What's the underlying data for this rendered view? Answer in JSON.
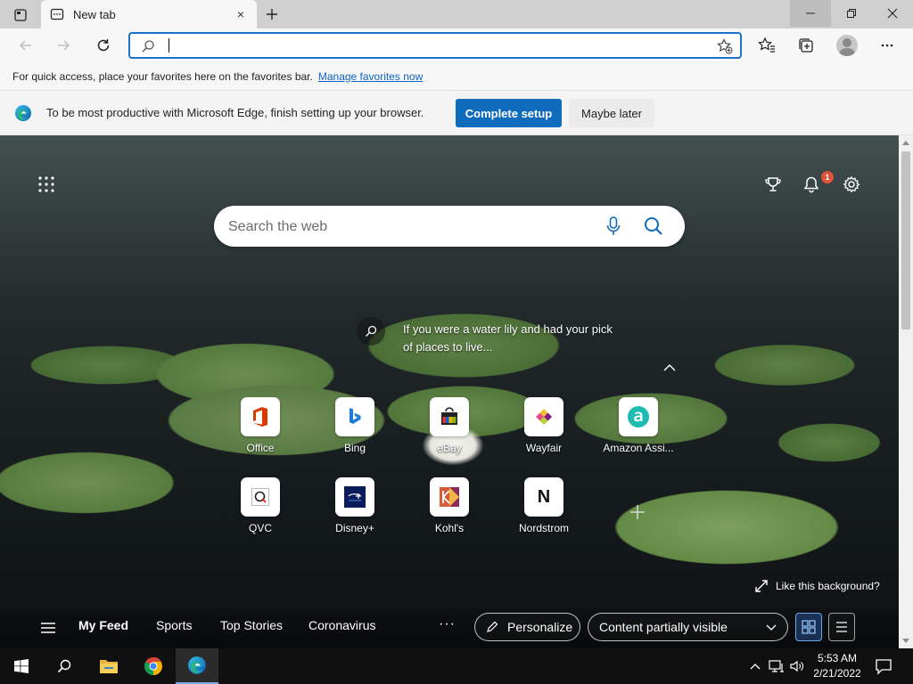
{
  "tab": {
    "title": "New tab",
    "close": "×"
  },
  "address": {
    "value": "",
    "placeholder": ""
  },
  "favorites_bar": {
    "text": "For quick access, place your favorites here on the favorites bar.",
    "link": "Manage favorites now"
  },
  "banner": {
    "text": "To be most productive with Microsoft Edge, finish setting up your browser.",
    "primary": "Complete setup",
    "secondary": "Maybe later"
  },
  "ntp": {
    "search_placeholder": "Search the web",
    "notification_count": "1",
    "story_line1": "If you were a water lily and had your pick",
    "story_line2": "of places to live...",
    "quick_links": [
      {
        "label": "Office",
        "icon": "office-icon"
      },
      {
        "label": "Bing",
        "icon": "bing-icon"
      },
      {
        "label": "eBay",
        "icon": "ebay-icon"
      },
      {
        "label": "Wayfair",
        "icon": "wayfair-icon"
      },
      {
        "label": "Amazon Assi...",
        "icon": "amazon-assistant-icon"
      },
      {
        "label": "QVC",
        "icon": "qvc-icon"
      },
      {
        "label": "Disney+",
        "icon": "disney-plus-icon"
      },
      {
        "label": "Kohl's",
        "icon": "kohls-icon"
      },
      {
        "label": "Nordstrom",
        "icon": "nordstrom-icon"
      }
    ],
    "nordstrom_letter": "N",
    "like_background": "Like this background?",
    "feed": {
      "tabs": [
        "My Feed",
        "Sports",
        "Top Stories",
        "Coronavirus"
      ],
      "more": "···",
      "personalize": "Personalize",
      "content_visibility": "Content partially visible"
    }
  },
  "taskbar": {
    "time": "5:53 AM",
    "date": "2/21/2022"
  },
  "colors": {
    "accent": "#0f6cbd",
    "address_border": "#1a73c8",
    "badge": "#e0533b",
    "taskbar": "#101010"
  }
}
